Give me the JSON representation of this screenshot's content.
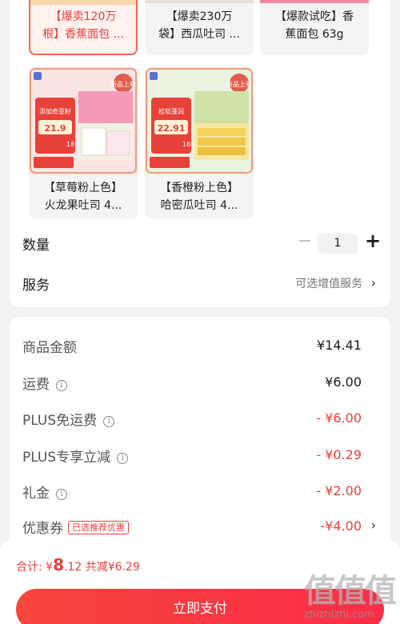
{
  "variants_top": [
    {
      "label_line1": "【爆卖120万",
      "label_line2": "根】香蕉面包 ...",
      "selected": true
    },
    {
      "label_line1": "【爆卖230万",
      "label_line2": "袋】西瓜吐司 ...",
      "selected": false
    },
    {
      "label_line1": "【爆款试吃】香",
      "label_line2": "蕉面包 63g",
      "selected": false
    }
  ],
  "variants": [
    {
      "label_line1": "【草莓粉上色】",
      "label_line2": "火龙果吐司 4...",
      "price_tag": "21.9",
      "badge_top": "新品上新",
      "headline": "添加奇亚籽",
      "count": "18"
    },
    {
      "label_line1": "【香橙粉上色】",
      "label_line2": "哈密瓜吐司 4...",
      "price_tag": "22.91",
      "badge_top": "新品上新",
      "headline": "松软蓬润",
      "count": "18"
    }
  ],
  "quantity": {
    "label": "数量",
    "minus": "−",
    "value": "1",
    "plus": "+"
  },
  "service": {
    "label": "服务",
    "value": "可选增值服务",
    "chevron": "›"
  },
  "price_rows": [
    {
      "label": "商品金额",
      "value": "¥14.41",
      "red": false
    },
    {
      "label": "运费",
      "value": "¥6.00",
      "red": false,
      "info": true
    },
    {
      "label": "PLUS免运费",
      "value": "- ¥6.00",
      "red": true,
      "info": true
    },
    {
      "label": "PLUS专享立减",
      "value": "- ¥0.29",
      "red": true,
      "info": true
    },
    {
      "label": "礼金",
      "value": "- ¥2.00",
      "red": true,
      "info": true
    },
    {
      "label": "优惠券",
      "value": "-¥4.00",
      "red": true,
      "badge": "已选推荐优惠",
      "chevron": "›"
    }
  ],
  "footer": {
    "total_prefix": "合计: ¥",
    "total_int": "8",
    "total_dec": ".12",
    "saved": " 共减¥6.29",
    "pay_label": "立即支付"
  },
  "watermark": {
    "mark": "值值值",
    "text": "zhizhizhi.com"
  },
  "colors": {
    "accent": "#e8413a",
    "selected_border": "#f36a4f"
  }
}
